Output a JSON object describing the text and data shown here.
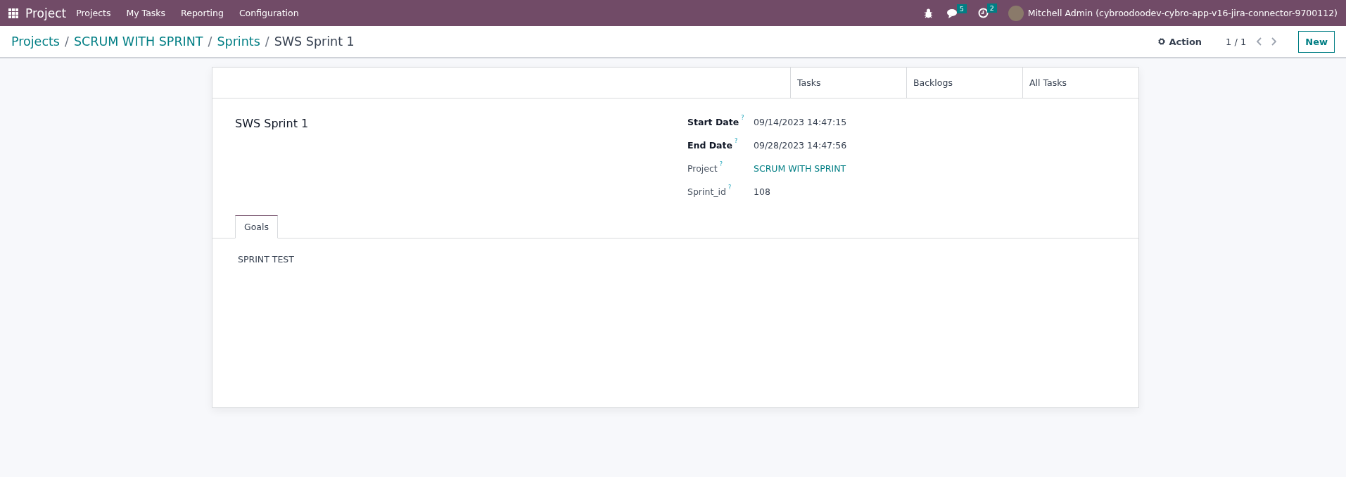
{
  "navbar": {
    "app_name": "Project",
    "menu": [
      "Projects",
      "My Tasks",
      "Reporting",
      "Configuration"
    ],
    "messages_count": "5",
    "activities_count": "2",
    "user": "Mitchell Admin (cybroodoodev-cybro-app-v16-jira-connector-9700112)"
  },
  "breadcrumbs": [
    {
      "label": "Projects",
      "kind": "link"
    },
    {
      "separator": "/",
      "label": "SCRUM WITH SPRINT",
      "kind": "link"
    },
    {
      "separator": "/",
      "label": "Sprints",
      "kind": "link"
    },
    {
      "separator": "/",
      "label": "SWS Sprint 1",
      "kind": "current"
    }
  ],
  "control_panel": {
    "action": "Action",
    "pager": "1 / 1",
    "new_button": "New"
  },
  "smart_buttons": [
    "Tasks",
    "Backlogs",
    "All Tasks"
  ],
  "form": {
    "title": "SWS Sprint 1",
    "fields": [
      {
        "label": "Start Date",
        "help": "?",
        "value": "09/14/2023 14:47:15",
        "required": true,
        "kind": "text"
      },
      {
        "label": "End Date",
        "help": "?",
        "value": "09/28/2023 14:47:56",
        "required": true,
        "kind": "text"
      },
      {
        "label": "Project",
        "help": "?",
        "value": "SCRUM WITH SPRINT",
        "required": false,
        "kind": "link"
      },
      {
        "label": "Sprint_id",
        "help": "?",
        "value": "108",
        "required": false,
        "kind": "text"
      }
    ],
    "tabs": [
      {
        "label": "Goals",
        "selected": true
      }
    ],
    "goals_text": "SPRINT TEST"
  }
}
